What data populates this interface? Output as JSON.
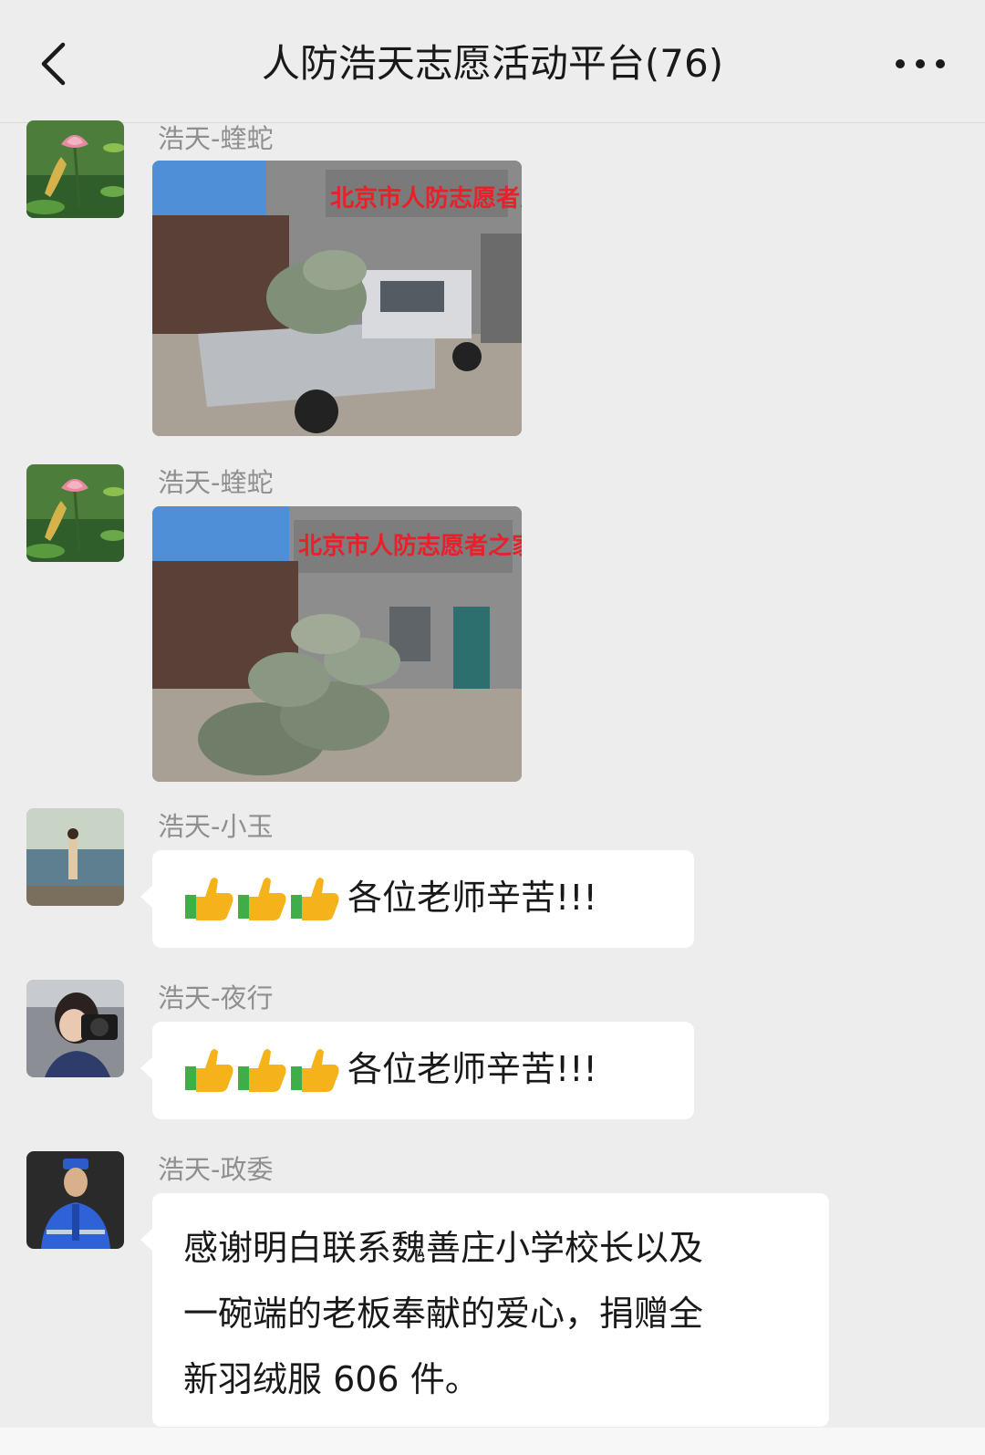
{
  "header": {
    "title": "人防浩天志愿活动平台(76)",
    "back_icon": "chevron-left-icon",
    "more_icon": "more-dots-icon"
  },
  "messages": [
    {
      "sender": "浩天-蝰蛇",
      "type": "image",
      "avatar": "lotus-flower-avatar",
      "image": "truck-loaded-with-bags-photo",
      "sign_text": "北京市人防志愿者之家"
    },
    {
      "sender": "浩天-蝰蛇",
      "type": "image",
      "avatar": "lotus-flower-avatar",
      "image": "bags-stacked-outside-building-photo",
      "sign_text": "北京市人防志愿者之家"
    },
    {
      "sender": "浩天-小玉",
      "type": "text",
      "avatar": "person-by-sea-avatar",
      "emoji": "thumbs-up-icon",
      "emoji_count": 3,
      "text": "各位老师辛苦!!!"
    },
    {
      "sender": "浩天-夜行",
      "type": "text",
      "avatar": "photographer-avatar",
      "emoji": "thumbs-up-icon",
      "emoji_count": 3,
      "text": "各位老师辛苦!!!"
    },
    {
      "sender": "浩天-政委",
      "type": "text",
      "avatar": "uniformed-person-avatar",
      "text_lines": [
        "感谢明白联系魏善庄小学校长以及",
        "一碗端的老板奉献的爱心，捐赠全",
        "新羽绒服 606 件。"
      ]
    }
  ],
  "colors": {
    "background": "#ededed",
    "bubble": "#ffffff",
    "sender_text": "#8f8f8f",
    "message_text": "#191919"
  }
}
